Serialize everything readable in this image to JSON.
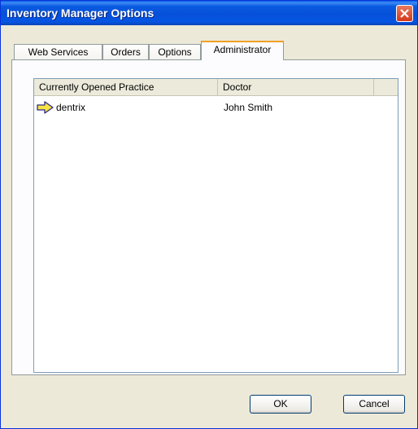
{
  "window": {
    "title": "Inventory Manager Options"
  },
  "tabs": [
    {
      "label": "Web Services"
    },
    {
      "label": "Orders"
    },
    {
      "label": "Options"
    },
    {
      "label": "Administrator"
    }
  ],
  "practice_list": {
    "columns": [
      "Currently Opened Practice",
      "Doctor"
    ],
    "rows": [
      {
        "practice": "dentrix",
        "doctor": "John Smith",
        "icon": "arrow-right-icon",
        "icon_color": "#f5e342"
      }
    ]
  },
  "buttons": {
    "ok": "OK",
    "cancel": "Cancel"
  },
  "colors": {
    "titlebar": "#0650d8",
    "close": "#d4381a",
    "active_tab_accent": "#f0a028"
  }
}
